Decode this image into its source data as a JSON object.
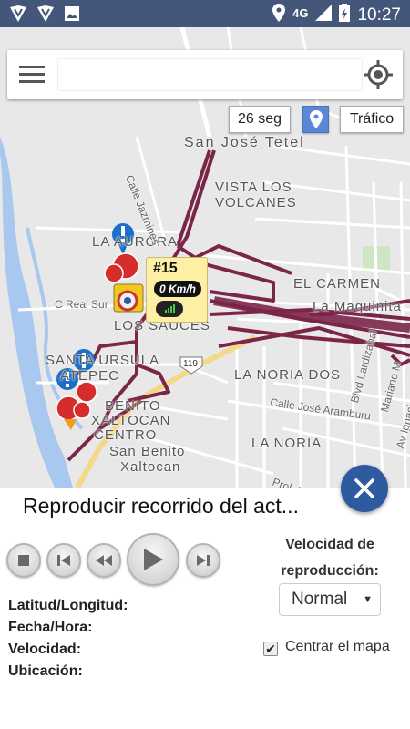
{
  "statusbar": {
    "network": "4G",
    "time": "10:27"
  },
  "search": {
    "value": "",
    "placeholder": ""
  },
  "map": {
    "refresh_label": "26 seg",
    "traffic_label": "Tráfico",
    "labels": [
      "San José Tetel",
      "VISTA LOS",
      "VOLCANES",
      "LA AURORA",
      "EL CARMEN",
      "La Maquinita",
      "C Real Sur",
      "LOS SAUCES",
      "SANTA URSULA",
      "ATEPEC",
      "LA NORIA DOS",
      "BENITO",
      "XALTOCAN",
      "CENTRO",
      "San Benito",
      "Xaltocan",
      "LA NORIA",
      "Calle José Aramburu",
      "Blvd Lardizabal",
      "Mariano M",
      "Av Ignacio",
      "Calle Jazmines",
      "Prol. Blvd",
      "119"
    ],
    "vehicle": {
      "id": "#15",
      "speed": "0 Km/h"
    }
  },
  "panel": {
    "title": "Reproducir recorrido del act...",
    "speed_label": "Velocidad de reproducción:",
    "speed_value": "Normal",
    "center_label": "Centrar el mapa",
    "center_checked": true,
    "info": [
      "Latitud/Longitud:",
      "Fecha/Hora:",
      "Velocidad:",
      "Ubicación:"
    ]
  }
}
